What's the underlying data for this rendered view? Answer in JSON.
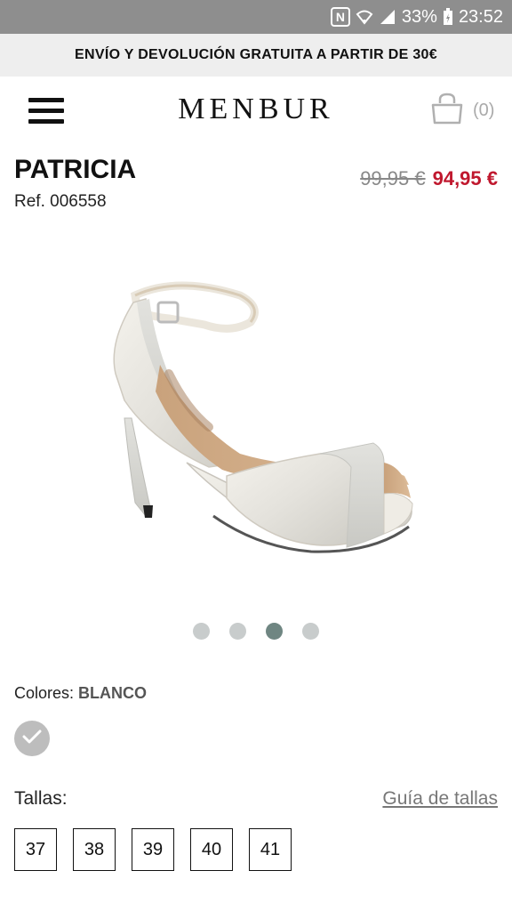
{
  "status_bar": {
    "nfc_label": "N",
    "battery": "33%",
    "time": "23:52"
  },
  "promo": {
    "text": "ENVÍO Y DEVOLUCIÓN GRATUITA A PARTIR DE 30€"
  },
  "header": {
    "logo": "MENBUR",
    "cart_count": "(0)",
    "menu_icon": "hamburger-menu-icon",
    "cart_icon": "shopping-bag-icon"
  },
  "product": {
    "name": "PATRICIA",
    "ref": "Ref. 006558",
    "old_price": "99,95 €",
    "price": "94,95 €",
    "image": "white-satin-high-heel-sandal"
  },
  "gallery": {
    "active_index": 2
  },
  "colors": {
    "label": "Colores:",
    "selected": "BLANCO",
    "swatch_color": "#bdbdbd"
  },
  "sizes": {
    "label": "Tallas:",
    "guide": "Guía de tallas",
    "options": [
      "37",
      "38",
      "39",
      "40",
      "41"
    ]
  },
  "accent": {
    "price_red": "#c0182e",
    "active_dot": "#6f8682"
  }
}
